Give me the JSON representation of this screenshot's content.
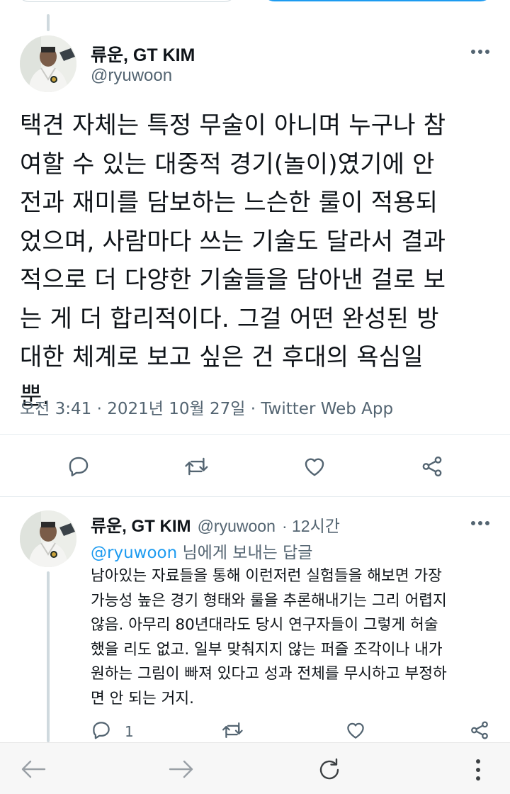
{
  "main_tweet": {
    "author_name": "류운, GT KIM",
    "author_handle": "@ryuwoon",
    "text": "택견 자체는 특정 무술이 아니며 누구나 참\n여할 수 있는 대중적 경기(놀이)였기에 안\n전과 재미를 담보하는 느슨한 룰이 적용되\n었으며, 사람마다 쓰는 기술도 달라서 결과\n적으로 더 다양한 기술들을 담아낸 걸로 보\n는 게 더 합리적이다. 그걸 어떤 완성된 방\n대한 체계로 보고 싶은 건 후대의 욕심일\n뿐.",
    "timestamp": "오전 3:41 · 2021년 10월 27일 · Twitter Web App",
    "actions": [
      "reply-icon",
      "retweet-icon",
      "like-icon",
      "share-icon"
    ]
  },
  "reply_tweet": {
    "author_name": "류운, GT KIM",
    "author_handle": "@ryuwoon",
    "time_ago": "· 12시간",
    "replying_to_mention": "@ryuwoon",
    "replying_to_suffix": " 님에게 보내는 답글",
    "text": "남아있는 자료들을 통해 이런저런 실험들을 해보면 가장\n가능성 높은 경기 형태와 룰을 추론해내기는 그리 어렵지\n않음. 아무리 80년대라도 당시 연구자들이 그렇게 허술\n했을 리도 없고. 일부 맞춰지지 않는 퍼즐 조각이나 내가\n원하는 그림이 빠져 있다고 성과 전체를 무시하고 부정하\n면 안 되는 거지.",
    "reply_count": "1"
  },
  "browser_bar": {
    "icons": [
      "back-arrow-icon",
      "forward-arrow-icon",
      "reload-icon",
      "menu-dots-icon"
    ]
  },
  "colors": {
    "text": "#0f1419",
    "secondary": "#536471",
    "accent": "#1d9bf0"
  }
}
